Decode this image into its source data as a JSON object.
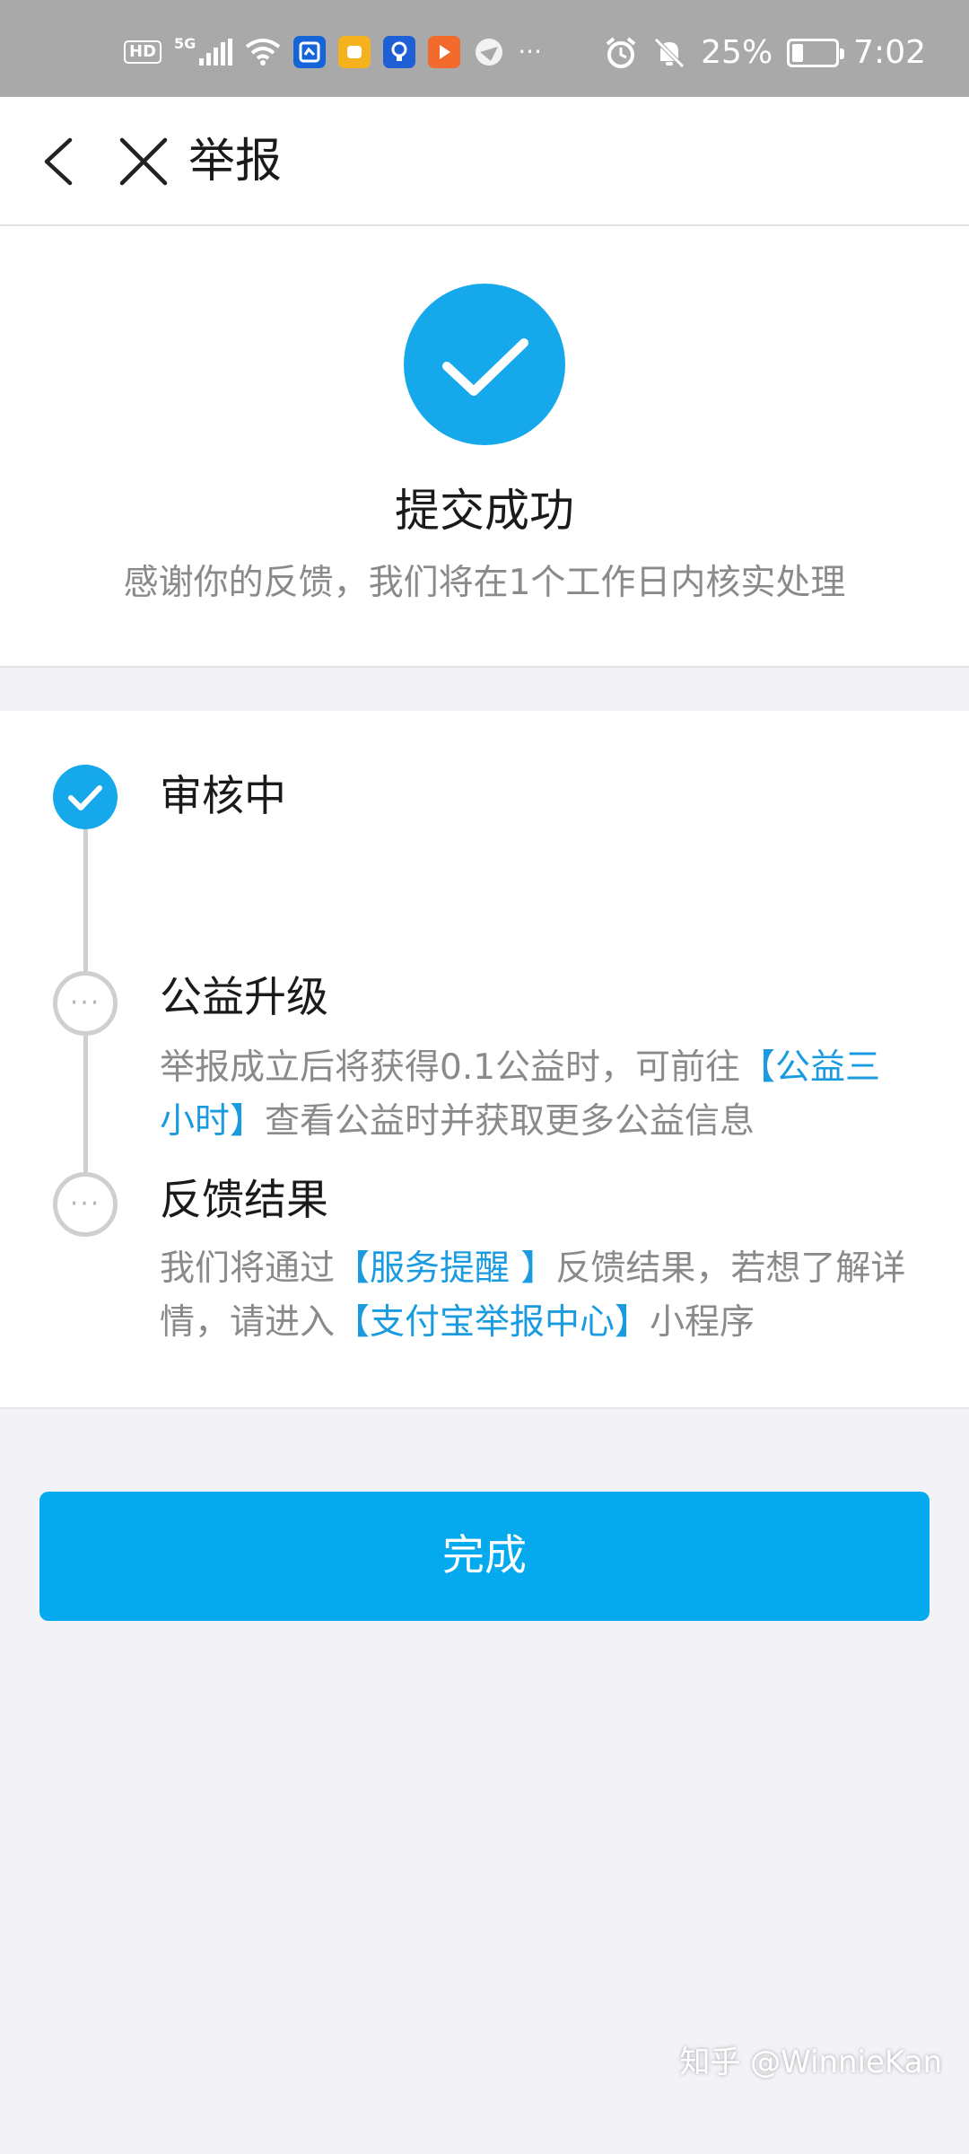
{
  "status_bar": {
    "hd": "HD",
    "network": "5G",
    "battery": "25%",
    "battery_level": 0.25,
    "time": "7:02",
    "more": "···"
  },
  "nav": {
    "title": "举报",
    "back_icon": "chevron-left-icon",
    "close_icon": "close-icon"
  },
  "success": {
    "title": "提交成功",
    "subtitle": "感谢你的反馈，我们将在1个工作日内核实处理"
  },
  "timeline": {
    "step1": {
      "title": "审核中"
    },
    "step2": {
      "title": "公益升级",
      "desc_before": "举报成立后将获得0.1公益时，可前往",
      "link": "【公益三小时】",
      "desc_after": "查看公益时并获取更多公益信息"
    },
    "step3": {
      "title": "反馈结果",
      "desc_before": "我们将通过",
      "link1": "【服务提醒 】",
      "desc_middle": "反馈结果，若想了解详情，请进入",
      "link2": "【支付宝举报中心】",
      "desc_after": "小程序"
    },
    "pending_dots": "···"
  },
  "done_button": {
    "label": "完成"
  },
  "watermark": "知乎 @WinnieKan",
  "colors": {
    "accent": "#15a9ec",
    "button": "#05a9ee",
    "link": "#1a9be0",
    "status_bar": "#a9a9a9"
  }
}
